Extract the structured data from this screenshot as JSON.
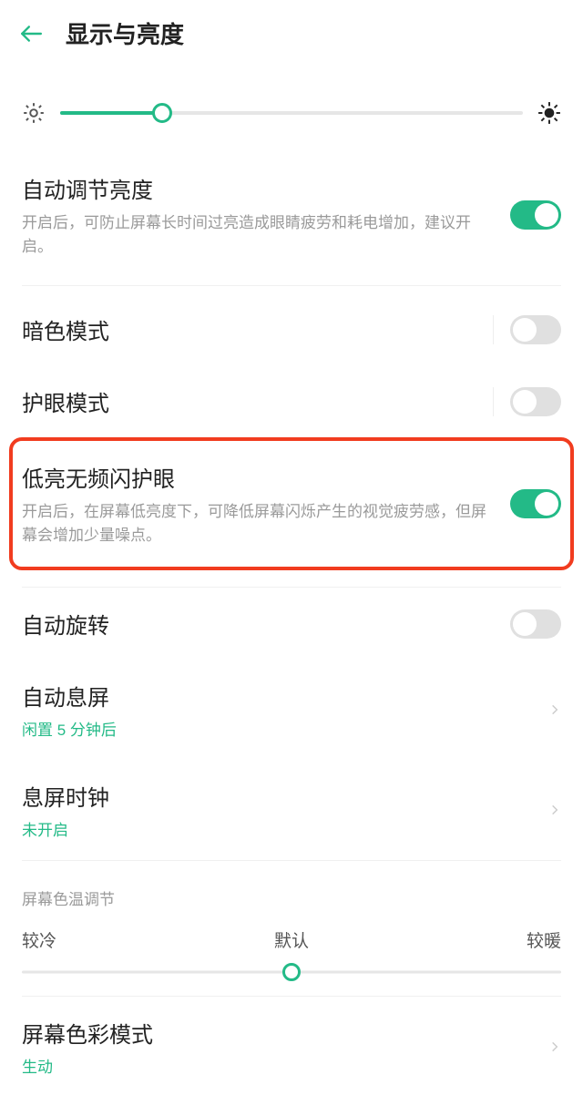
{
  "header": {
    "title": "显示与亮度"
  },
  "brightness": {
    "percent": 22
  },
  "auto_brightness": {
    "title": "自动调节亮度",
    "desc": "开启后，可防止屏幕长时间过亮造成眼睛疲劳和耗电增加，建议开启。",
    "on": true
  },
  "dark_mode": {
    "title": "暗色模式",
    "on": false
  },
  "eye_protect": {
    "title": "护眼模式",
    "on": false
  },
  "dc_dimming": {
    "title": "低亮无频闪护眼",
    "desc": "开启后，在屏幕低亮度下，可降低屏幕闪烁产生的视觉疲劳感，但屏幕会增加少量噪点。",
    "on": true
  },
  "auto_rotate": {
    "title": "自动旋转",
    "on": false
  },
  "auto_sleep": {
    "title": "自动息屏",
    "sub": "闲置 5 分钟后"
  },
  "aod": {
    "title": "息屏时钟",
    "sub": "未开启"
  },
  "color_temp": {
    "section": "屏幕色温调节",
    "cold": "较冷",
    "default": "默认",
    "warm": "较暖",
    "percent": 50
  },
  "color_mode": {
    "title": "屏幕色彩模式",
    "sub": "生动"
  }
}
